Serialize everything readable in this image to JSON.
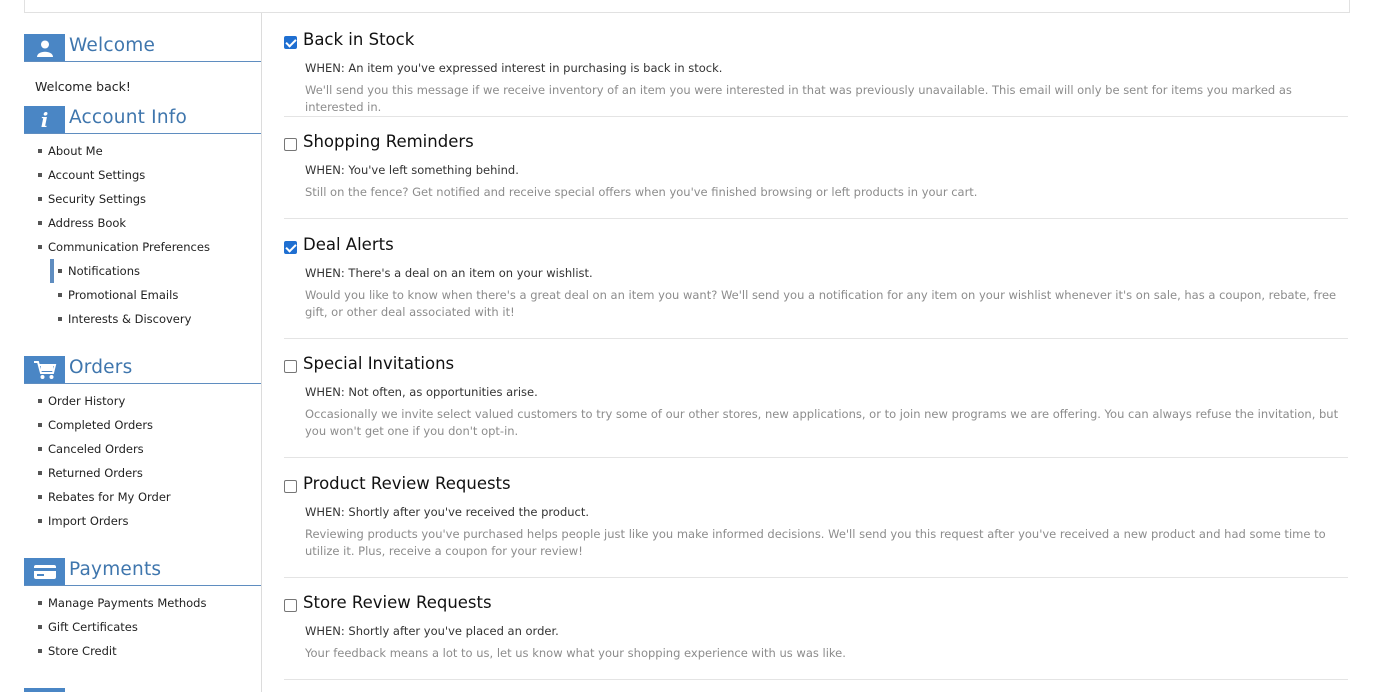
{
  "sidebar": {
    "welcome": {
      "title": "Welcome",
      "icon": "user-icon",
      "message": "Welcome back!"
    },
    "account": {
      "title": "Account Info",
      "icon": "info-icon",
      "items": [
        "About Me",
        "Account Settings",
        "Security Settings",
        "Address Book",
        "Communication Preferences"
      ],
      "sub_items": [
        "Notifications",
        "Promotional Emails",
        "Interests & Discovery"
      ],
      "active_sub_item": "Notifications"
    },
    "orders": {
      "title": "Orders",
      "icon": "cart-icon",
      "items": [
        "Order History",
        "Completed Orders",
        "Canceled Orders",
        "Returned Orders",
        "Rebates for My Order",
        "Import Orders"
      ]
    },
    "payments": {
      "title": "Payments",
      "icon": "credit-card-icon",
      "items": [
        "Manage Payments Methods",
        "Gift Certificates",
        "Store Credit"
      ]
    }
  },
  "preferences": [
    {
      "title": "Back in Stock",
      "checked": true,
      "when": "WHEN: An item you've expressed interest in purchasing is back in stock.",
      "description": "We'll send you this message if we receive inventory of an item you were interested in that was previously unavailable. This email will only be sent for items you marked as interested in."
    },
    {
      "title": "Shopping Reminders",
      "checked": false,
      "when": "WHEN: You've left something behind.",
      "description": "Still on the fence? Get notified and receive special offers when you've finished browsing or left products in your cart."
    },
    {
      "title": "Deal Alerts",
      "checked": true,
      "when": "WHEN: There's a deal on an item on your wishlist.",
      "description": "Would you like to know when there's a great deal on an item you want? We'll send you a notification for any item on your wishlist whenever it's on sale, has a coupon, rebate, free gift, or other deal associated with it!"
    },
    {
      "title": "Special Invitations",
      "checked": false,
      "when": "WHEN: Not often, as opportunities arise.",
      "description": "Occasionally we invite select valued customers to try some of our other stores, new applications, or to join new programs we are offering. You can always refuse the invitation, but you won't get one if you don't opt-in."
    },
    {
      "title": "Product Review Requests",
      "checked": false,
      "when": "WHEN: Shortly after you've received the product.",
      "description": "Reviewing products you've purchased helps people just like you make informed decisions. We'll send you this request after you've received a new product and had some time to utilize it. Plus, receive a coupon for your review!"
    },
    {
      "title": "Store Review Requests",
      "checked": false,
      "when": "WHEN: Shortly after you've placed an order.",
      "description": "Your feedback means a lot to us, let us know what your shopping experience with us was like."
    }
  ],
  "colors": {
    "accent": "#4a86c5",
    "heading": "#3f76ad",
    "checkbox_on": "#1f6fd1",
    "muted_text": "#8c8c8c"
  }
}
